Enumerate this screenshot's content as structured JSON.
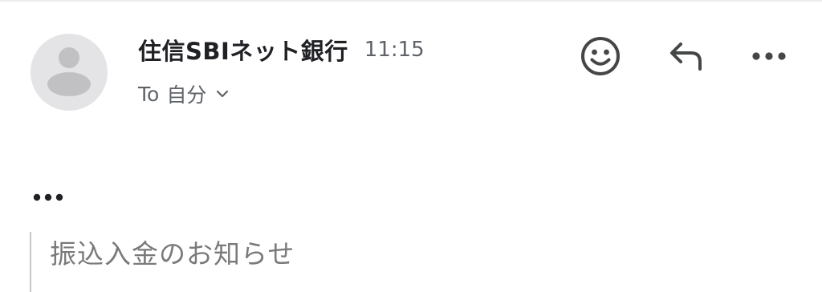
{
  "message": {
    "sender": "住信SBIネット銀行",
    "time": "11:15",
    "recipient_prefix": "To",
    "recipient": "自分",
    "quoted_subject": "振込入金のお知らせ"
  },
  "icons": {
    "avatar": "person-placeholder-icon",
    "recipient_details": "chevron-down-icon",
    "react": "smiley-face-icon",
    "reply": "reply-arrow-icon",
    "more": "more-horizontal-icon",
    "trimmed_content": "ellipsis-icon"
  },
  "colors": {
    "primary_text": "#202124",
    "secondary_text": "#5f6368",
    "icon": "#444746",
    "avatar_bg": "#e4e4e6",
    "avatar_fg": "#c1c1c4"
  }
}
